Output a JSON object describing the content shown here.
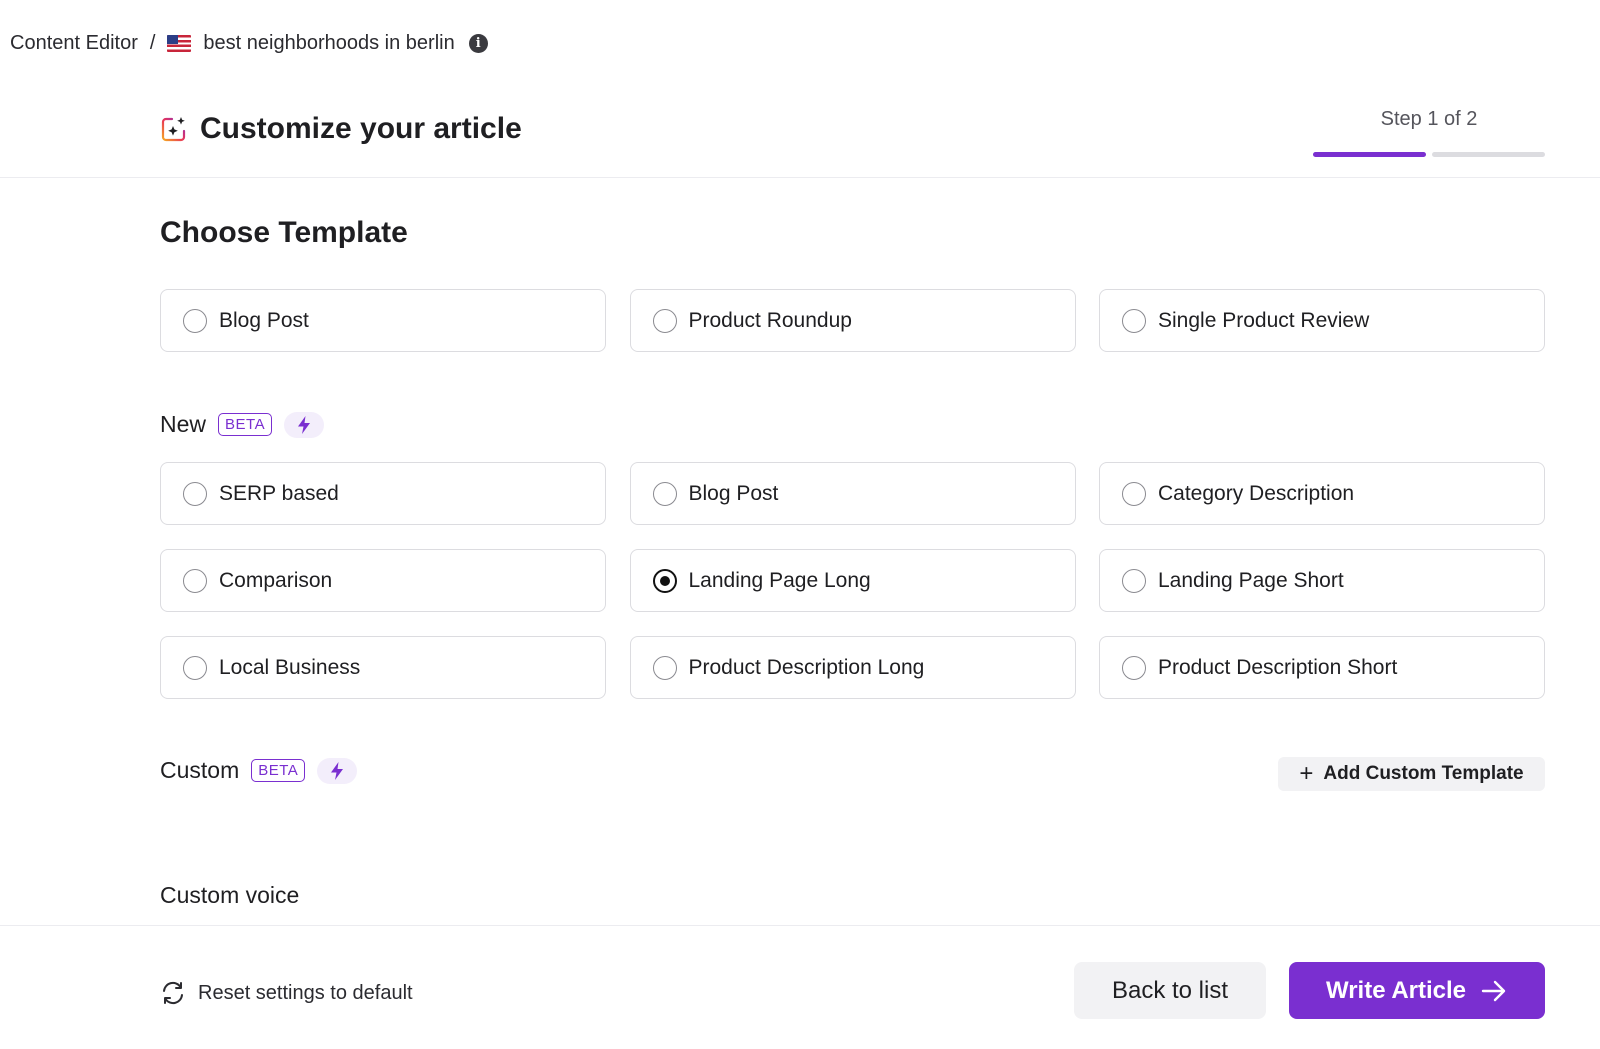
{
  "breadcrumb": {
    "root": "Content Editor",
    "separator": "/",
    "flag_icon": "us-flag-icon",
    "keyword": "best neighborhoods in berlin",
    "info_icon": "info-icon"
  },
  "header": {
    "title": "Customize your article",
    "icon": "sparkle-icon",
    "step_label": "Step 1 of 2",
    "step_current": 1,
    "step_total": 2
  },
  "template_section": {
    "title": "Choose Template",
    "standard_options": [
      {
        "label": "Blog Post",
        "selected": false
      },
      {
        "label": "Product Roundup",
        "selected": false
      },
      {
        "label": "Single Product Review",
        "selected": false
      }
    ],
    "new_group": {
      "label": "New",
      "badge": "BETA",
      "badge_icon": "lightning-icon"
    },
    "new_options": [
      {
        "label": "SERP based",
        "selected": false
      },
      {
        "label": "Blog Post",
        "selected": false
      },
      {
        "label": "Category Description",
        "selected": false
      },
      {
        "label": "Comparison",
        "selected": false
      },
      {
        "label": "Landing Page Long",
        "selected": true
      },
      {
        "label": "Landing Page Short",
        "selected": false
      },
      {
        "label": "Local Business",
        "selected": false
      },
      {
        "label": "Product Description Long",
        "selected": false
      },
      {
        "label": "Product Description Short",
        "selected": false
      }
    ],
    "custom_group": {
      "label": "Custom",
      "badge": "BETA",
      "badge_icon": "lightning-icon",
      "add_button": "Add Custom Template"
    }
  },
  "voice": {
    "label": "Custom voice"
  },
  "footer": {
    "reset_label": "Reset settings to default",
    "back_label": "Back to list",
    "write_label": "Write Article"
  },
  "colors": {
    "accent": "#7a2fd0",
    "accent_light": "#f3eefb",
    "border": "#dcdce0",
    "text": "#1f1f22"
  }
}
